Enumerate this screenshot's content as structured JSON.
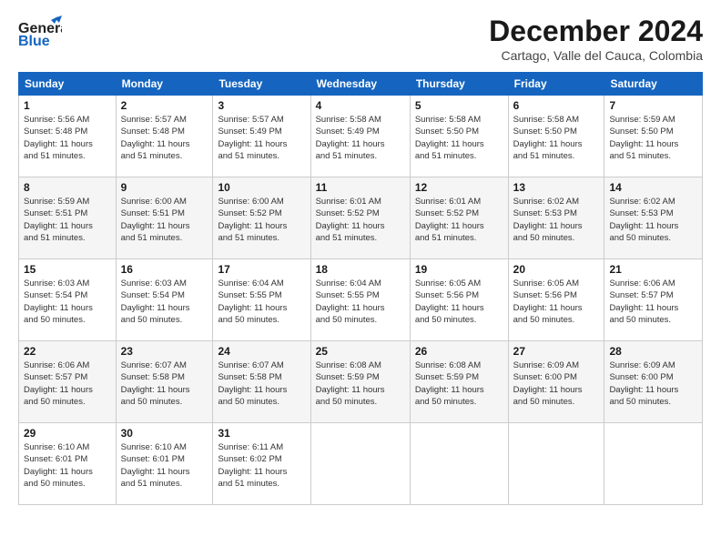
{
  "logo": {
    "line1": "General",
    "line2": "Blue"
  },
  "title": "December 2024",
  "subtitle": "Cartago, Valle del Cauca, Colombia",
  "days_of_week": [
    "Sunday",
    "Monday",
    "Tuesday",
    "Wednesday",
    "Thursday",
    "Friday",
    "Saturday"
  ],
  "weeks": [
    [
      {
        "day": "1",
        "sunrise": "5:56 AM",
        "sunset": "5:48 PM",
        "daylight": "11 hours and 51 minutes."
      },
      {
        "day": "2",
        "sunrise": "5:57 AM",
        "sunset": "5:48 PM",
        "daylight": "11 hours and 51 minutes."
      },
      {
        "day": "3",
        "sunrise": "5:57 AM",
        "sunset": "5:49 PM",
        "daylight": "11 hours and 51 minutes."
      },
      {
        "day": "4",
        "sunrise": "5:58 AM",
        "sunset": "5:49 PM",
        "daylight": "11 hours and 51 minutes."
      },
      {
        "day": "5",
        "sunrise": "5:58 AM",
        "sunset": "5:50 PM",
        "daylight": "11 hours and 51 minutes."
      },
      {
        "day": "6",
        "sunrise": "5:58 AM",
        "sunset": "5:50 PM",
        "daylight": "11 hours and 51 minutes."
      },
      {
        "day": "7",
        "sunrise": "5:59 AM",
        "sunset": "5:50 PM",
        "daylight": "11 hours and 51 minutes."
      }
    ],
    [
      {
        "day": "8",
        "sunrise": "5:59 AM",
        "sunset": "5:51 PM",
        "daylight": "11 hours and 51 minutes."
      },
      {
        "day": "9",
        "sunrise": "6:00 AM",
        "sunset": "5:51 PM",
        "daylight": "11 hours and 51 minutes."
      },
      {
        "day": "10",
        "sunrise": "6:00 AM",
        "sunset": "5:52 PM",
        "daylight": "11 hours and 51 minutes."
      },
      {
        "day": "11",
        "sunrise": "6:01 AM",
        "sunset": "5:52 PM",
        "daylight": "11 hours and 51 minutes."
      },
      {
        "day": "12",
        "sunrise": "6:01 AM",
        "sunset": "5:52 PM",
        "daylight": "11 hours and 51 minutes."
      },
      {
        "day": "13",
        "sunrise": "6:02 AM",
        "sunset": "5:53 PM",
        "daylight": "11 hours and 50 minutes."
      },
      {
        "day": "14",
        "sunrise": "6:02 AM",
        "sunset": "5:53 PM",
        "daylight": "11 hours and 50 minutes."
      }
    ],
    [
      {
        "day": "15",
        "sunrise": "6:03 AM",
        "sunset": "5:54 PM",
        "daylight": "11 hours and 50 minutes."
      },
      {
        "day": "16",
        "sunrise": "6:03 AM",
        "sunset": "5:54 PM",
        "daylight": "11 hours and 50 minutes."
      },
      {
        "day": "17",
        "sunrise": "6:04 AM",
        "sunset": "5:55 PM",
        "daylight": "11 hours and 50 minutes."
      },
      {
        "day": "18",
        "sunrise": "6:04 AM",
        "sunset": "5:55 PM",
        "daylight": "11 hours and 50 minutes."
      },
      {
        "day": "19",
        "sunrise": "6:05 AM",
        "sunset": "5:56 PM",
        "daylight": "11 hours and 50 minutes."
      },
      {
        "day": "20",
        "sunrise": "6:05 AM",
        "sunset": "5:56 PM",
        "daylight": "11 hours and 50 minutes."
      },
      {
        "day": "21",
        "sunrise": "6:06 AM",
        "sunset": "5:57 PM",
        "daylight": "11 hours and 50 minutes."
      }
    ],
    [
      {
        "day": "22",
        "sunrise": "6:06 AM",
        "sunset": "5:57 PM",
        "daylight": "11 hours and 50 minutes."
      },
      {
        "day": "23",
        "sunrise": "6:07 AM",
        "sunset": "5:58 PM",
        "daylight": "11 hours and 50 minutes."
      },
      {
        "day": "24",
        "sunrise": "6:07 AM",
        "sunset": "5:58 PM",
        "daylight": "11 hours and 50 minutes."
      },
      {
        "day": "25",
        "sunrise": "6:08 AM",
        "sunset": "5:59 PM",
        "daylight": "11 hours and 50 minutes."
      },
      {
        "day": "26",
        "sunrise": "6:08 AM",
        "sunset": "5:59 PM",
        "daylight": "11 hours and 50 minutes."
      },
      {
        "day": "27",
        "sunrise": "6:09 AM",
        "sunset": "6:00 PM",
        "daylight": "11 hours and 50 minutes."
      },
      {
        "day": "28",
        "sunrise": "6:09 AM",
        "sunset": "6:00 PM",
        "daylight": "11 hours and 50 minutes."
      }
    ],
    [
      {
        "day": "29",
        "sunrise": "6:10 AM",
        "sunset": "6:01 PM",
        "daylight": "11 hours and 50 minutes."
      },
      {
        "day": "30",
        "sunrise": "6:10 AM",
        "sunset": "6:01 PM",
        "daylight": "11 hours and 51 minutes."
      },
      {
        "day": "31",
        "sunrise": "6:11 AM",
        "sunset": "6:02 PM",
        "daylight": "11 hours and 51 minutes."
      },
      null,
      null,
      null,
      null
    ]
  ],
  "sunrise_label": "Sunrise:",
  "sunset_label": "Sunset:",
  "daylight_label": "Daylight:"
}
